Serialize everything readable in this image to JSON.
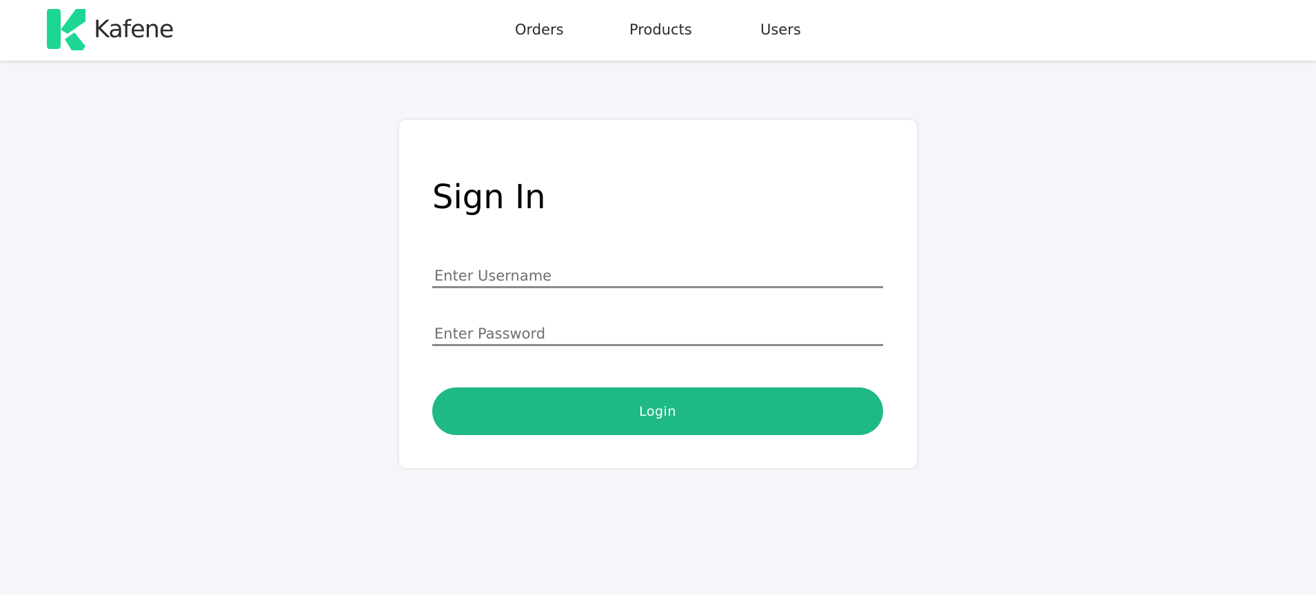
{
  "header": {
    "brand": "Kafene",
    "logo_icon": "kafene-logo-icon",
    "nav": [
      {
        "label": "Orders"
      },
      {
        "label": "Products"
      },
      {
        "label": "Users"
      }
    ]
  },
  "login": {
    "title": "Sign In",
    "username_placeholder": "Enter Username",
    "username_value": "",
    "password_placeholder": "Enter Password",
    "password_value": "",
    "button_label": "Login"
  },
  "colors": {
    "accent": "#1fb985",
    "logo": "#1ed694",
    "background": "#f4f6f9",
    "card": "#ffffff"
  }
}
